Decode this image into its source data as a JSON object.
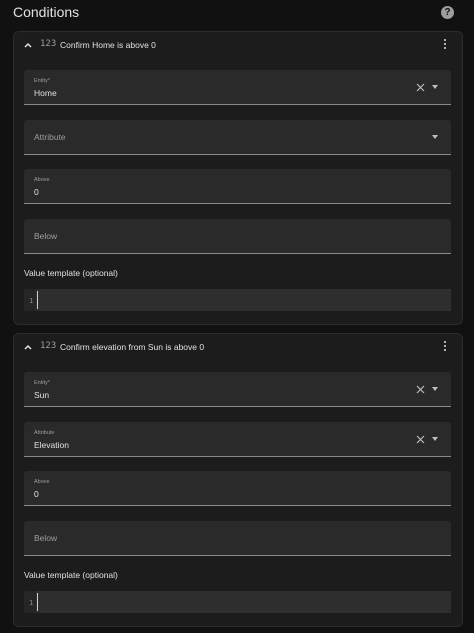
{
  "header": {
    "title": "Conditions",
    "help_icon": "help-circle-icon"
  },
  "conditions": [
    {
      "title": "Confirm Home is above 0",
      "entity": {
        "label": "Entity*",
        "value": "Home"
      },
      "attribute": {
        "placeholder": "Attribute"
      },
      "above": {
        "label": "Above",
        "value": "0"
      },
      "below": {
        "placeholder": "Below"
      },
      "value_template_label": "Value template (optional)",
      "line_number": "1"
    },
    {
      "title": "Confirm elevation from Sun is above 0",
      "entity": {
        "label": "Entity*",
        "value": "Sun"
      },
      "attribute": {
        "label": "Attribute",
        "value": "Elevation"
      },
      "above": {
        "label": "Above",
        "value": "0"
      },
      "below": {
        "placeholder": "Below"
      },
      "value_template_label": "Value template (optional)",
      "line_number": "1"
    }
  ],
  "icons": {
    "collapse": "chevron-up-icon",
    "type": "numeric-icon",
    "menu": "dots-vertical-icon",
    "clear": "close-icon",
    "dropdown": "menu-down-icon"
  },
  "colors": {
    "background": "#111111",
    "card": "#1c1c1c",
    "field": "#2a2a2a",
    "text": "#e1e1e1",
    "secondary_text": "#9e9e9e"
  }
}
